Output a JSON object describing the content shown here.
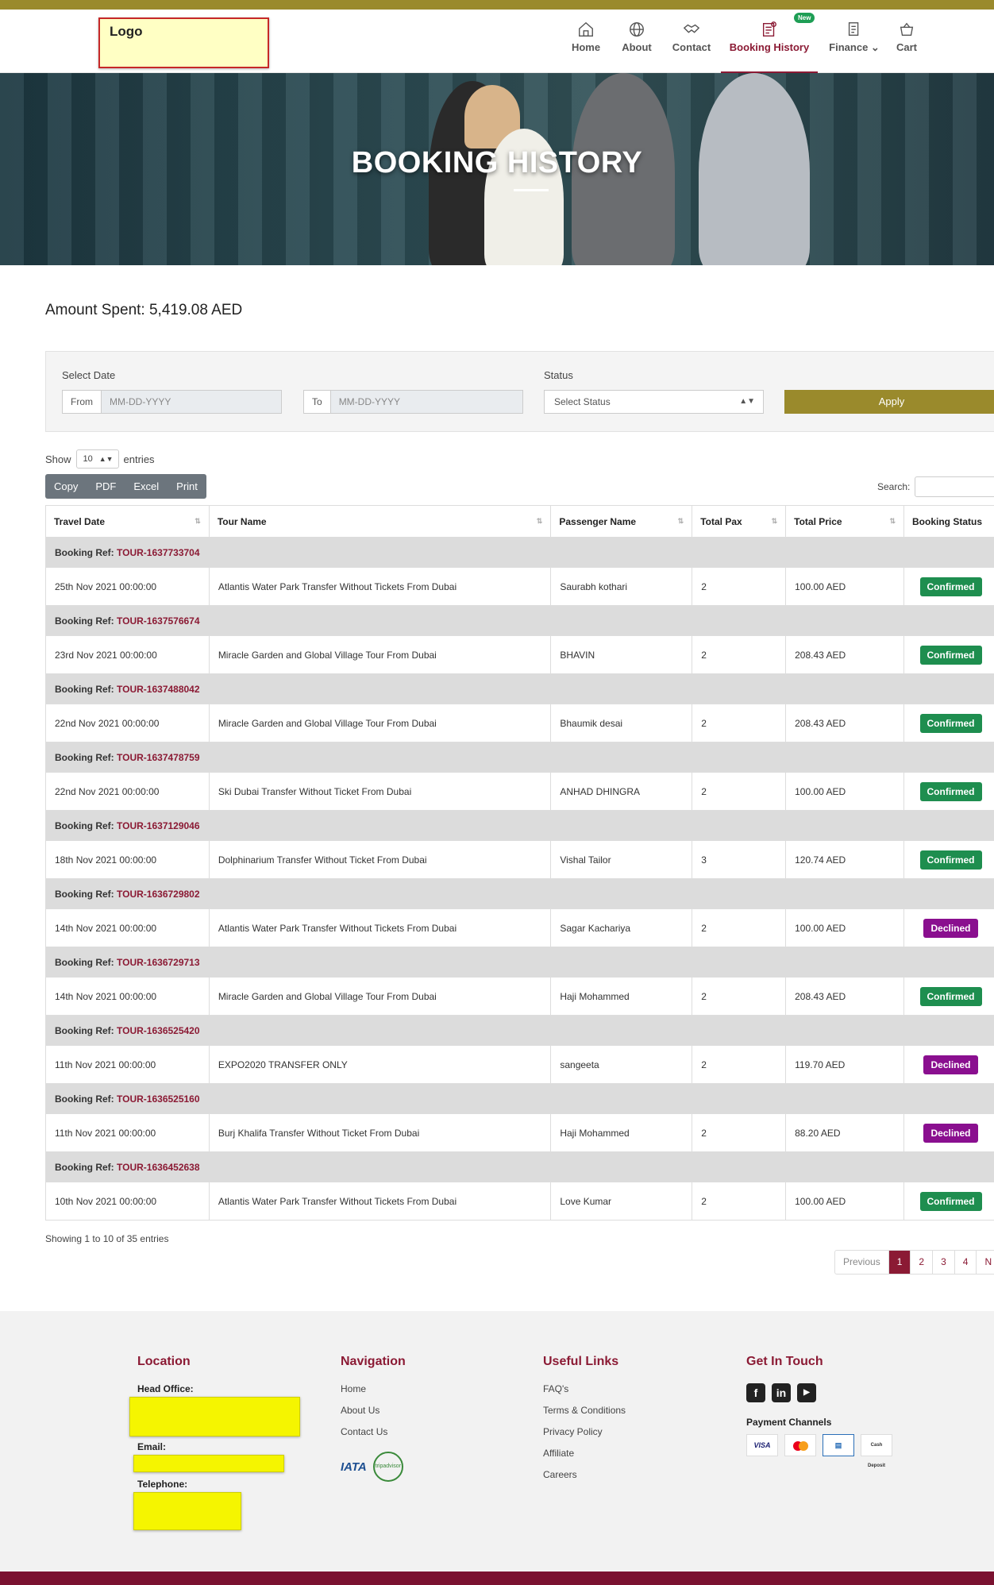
{
  "header": {
    "logo_text": "Logo",
    "nav": [
      {
        "label": "Home",
        "icon": "home-icon"
      },
      {
        "label": "About",
        "icon": "globe-icon"
      },
      {
        "label": "Contact",
        "icon": "handshake-icon"
      },
      {
        "label": "Booking History",
        "icon": "booking-icon",
        "badge": "New",
        "active": true
      },
      {
        "label": "Finance",
        "icon": "finance-icon",
        "dropdown": true
      },
      {
        "label": "Cart",
        "icon": "cart-icon"
      }
    ]
  },
  "hero": {
    "title": "BOOKING HISTORY"
  },
  "amount": {
    "text": "Amount Spent: 5,419.08 AED"
  },
  "filters": {
    "date_label": "Select Date",
    "from_addon": "From",
    "from_placeholder": "MM-DD-YYYY",
    "to_addon": "To",
    "to_placeholder": "MM-DD-YYYY",
    "status_label": "Status",
    "status_value": "Select Status",
    "apply_label": "Apply"
  },
  "table_controls": {
    "show_label": "Show",
    "entries_value": "10",
    "entries_label": "entries",
    "buttons": [
      "Copy",
      "PDF",
      "Excel",
      "Print"
    ],
    "search_label": "Search:"
  },
  "table": {
    "columns": [
      "Travel Date",
      "Tour Name",
      "Passenger Name",
      "Total Pax",
      "Total Price",
      "Booking Status"
    ],
    "ref_prefix": "Booking Ref:",
    "rows": [
      {
        "ref": "TOUR-1637733704",
        "date": "25th Nov 2021 00:00:00",
        "tour": "Atlantis Water Park Transfer Without Tickets From Dubai",
        "passenger": "Saurabh kothari",
        "pax": "2",
        "price": "100.00 AED",
        "status": "Confirmed"
      },
      {
        "ref": "TOUR-1637576674",
        "date": "23rd Nov 2021 00:00:00",
        "tour": "Miracle Garden and Global Village Tour From Dubai",
        "passenger": "BHAVIN",
        "pax": "2",
        "price": "208.43 AED",
        "status": "Confirmed"
      },
      {
        "ref": "TOUR-1637488042",
        "date": "22nd Nov 2021 00:00:00",
        "tour": "Miracle Garden and Global Village Tour From Dubai",
        "passenger": "Bhaumik desai",
        "pax": "2",
        "price": "208.43 AED",
        "status": "Confirmed"
      },
      {
        "ref": "TOUR-1637478759",
        "date": "22nd Nov 2021 00:00:00",
        "tour": "Ski Dubai Transfer Without Ticket From Dubai",
        "passenger": "ANHAD DHINGRA",
        "pax": "2",
        "price": "100.00 AED",
        "status": "Confirmed"
      },
      {
        "ref": "TOUR-1637129046",
        "date": "18th Nov 2021 00:00:00",
        "tour": "Dolphinarium Transfer Without Ticket From Dubai",
        "passenger": "Vishal Tailor",
        "pax": "3",
        "price": "120.74 AED",
        "status": "Confirmed"
      },
      {
        "ref": "TOUR-1636729802",
        "date": "14th Nov 2021 00:00:00",
        "tour": "Atlantis Water Park Transfer Without Tickets From Dubai",
        "passenger": "Sagar Kachariya",
        "pax": "2",
        "price": "100.00 AED",
        "status": "Declined"
      },
      {
        "ref": "TOUR-1636729713",
        "date": "14th Nov 2021 00:00:00",
        "tour": "Miracle Garden and Global Village Tour From Dubai",
        "passenger": "Haji Mohammed",
        "pax": "2",
        "price": "208.43 AED",
        "status": "Confirmed"
      },
      {
        "ref": "TOUR-1636525420",
        "date": "11th Nov 2021 00:00:00",
        "tour": "EXPO2020 TRANSFER ONLY",
        "passenger": "sangeeta",
        "pax": "2",
        "price": "119.70 AED",
        "status": "Declined"
      },
      {
        "ref": "TOUR-1636525160",
        "date": "11th Nov 2021 00:00:00",
        "tour": "Burj Khalifa Transfer Without Ticket From Dubai",
        "passenger": "Haji Mohammed",
        "pax": "2",
        "price": "88.20 AED",
        "status": "Declined"
      },
      {
        "ref": "TOUR-1636452638",
        "date": "10th Nov 2021 00:00:00",
        "tour": "Atlantis Water Park Transfer Without Tickets From Dubai",
        "passenger": "Love Kumar",
        "pax": "2",
        "price": "100.00 AED",
        "status": "Confirmed"
      }
    ]
  },
  "pagination": {
    "info": "Showing 1 to 10 of 35 entries",
    "previous": "Previous",
    "pages": [
      "1",
      "2",
      "3",
      "4"
    ],
    "next": "N"
  },
  "footer": {
    "location": {
      "title": "Location",
      "head_office_label": "Head Office:",
      "email_label": "Email:",
      "telephone_label": "Telephone:"
    },
    "navigation": {
      "title": "Navigation",
      "links": [
        "Home",
        "About Us",
        "Contact Us"
      ],
      "logos": [
        "IATA",
        "tripadvisor"
      ]
    },
    "useful_links": {
      "title": "Useful Links",
      "links": [
        "FAQ's",
        "Terms & Conditions",
        "Privacy Policy",
        "Affiliate",
        "Careers"
      ]
    },
    "get_in_touch": {
      "title": "Get In Touch",
      "social": [
        "facebook-icon",
        "linkedin-icon",
        "youtube-icon"
      ],
      "payment_label": "Payment Channels",
      "payment_methods": [
        "VISA",
        "mastercard",
        "cheque",
        "Cash Deposit"
      ]
    }
  },
  "colors": {
    "brand": "#8b1a34",
    "gold": "#9a8a2c",
    "confirmed": "#1e8e4f",
    "declined": "#8a0f8f"
  }
}
